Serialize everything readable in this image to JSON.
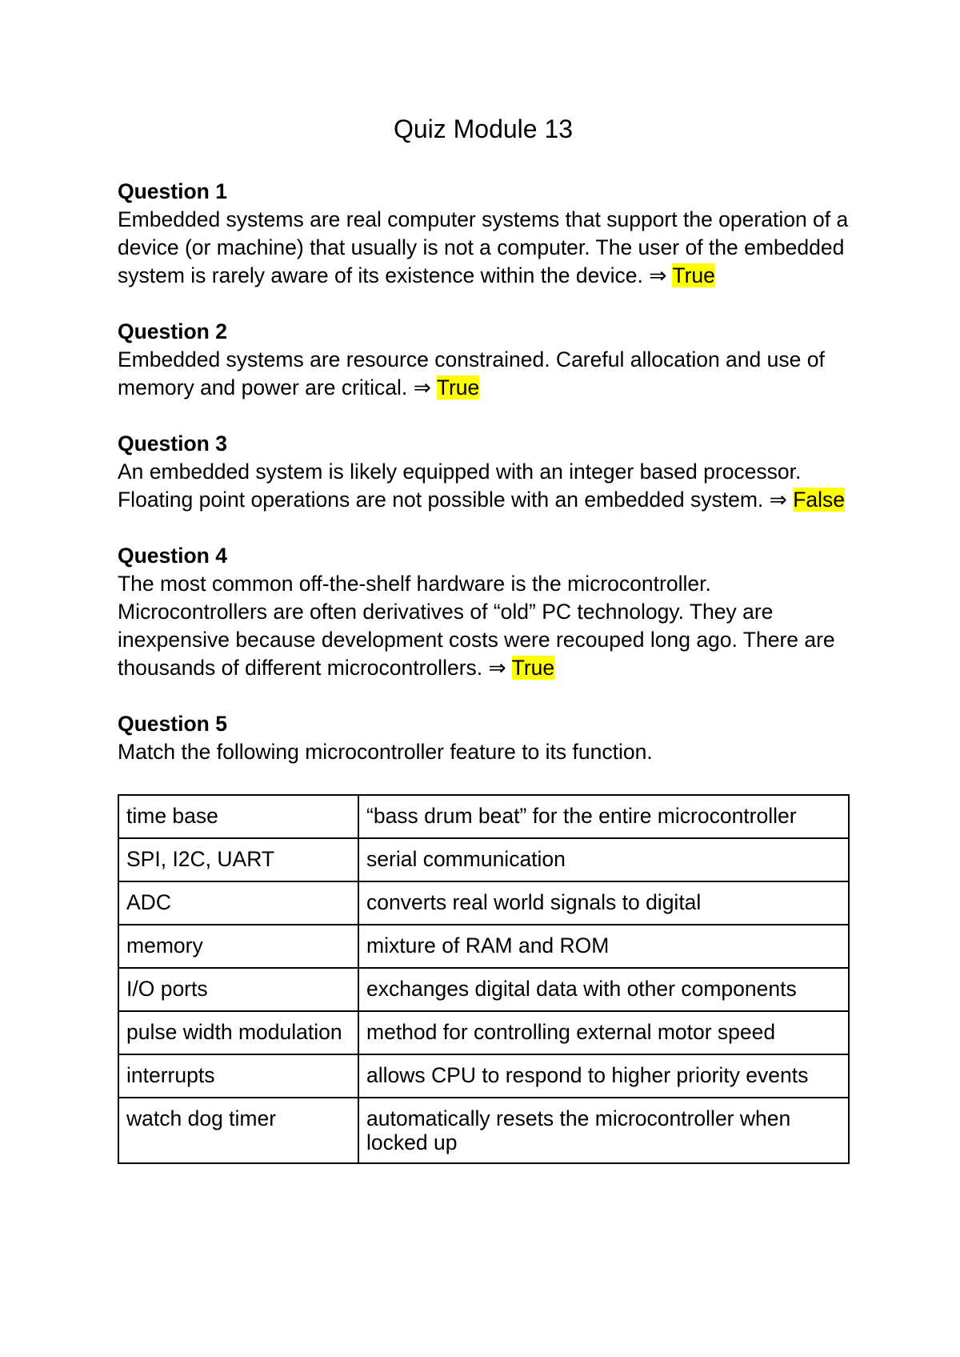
{
  "document": {
    "title": "Quiz Module 13",
    "arrow": "⇒",
    "questions": [
      {
        "heading": "Question 1",
        "text": "Embedded systems are real computer systems that support the operation of a device (or machine) that usually is not a computer. The user of the embedded system is rarely aware of its existence within the device.",
        "answer": "True"
      },
      {
        "heading": "Question 2",
        "text": "Embedded systems are resource constrained. Careful allocation and use of memory and power are critical.",
        "answer": "True"
      },
      {
        "heading": "Question 3",
        "text": "An embedded system is likely equipped with an integer based processor. Floating point operations are not possible with an embedded system.",
        "answer": "False"
      },
      {
        "heading": "Question 4",
        "text": "The most common off-the-shelf hardware is the microcontroller. Microcontrollers are often derivatives of “old” PC technology. They are inexpensive because development costs were recouped long ago. There are thousands of different microcontrollers.",
        "answer": "True"
      },
      {
        "heading": "Question 5",
        "text": "Match the following microcontroller feature to its function."
      }
    ],
    "highlight_color": "#ffff00",
    "match_table": [
      {
        "feature": "time base",
        "function": "“bass drum beat” for the entire microcontroller"
      },
      {
        "feature": "SPI, I2C, UART",
        "function": "serial communication"
      },
      {
        "feature": "ADC",
        "function": "converts real world signals to digital"
      },
      {
        "feature": "memory",
        "function": "mixture of RAM and ROM"
      },
      {
        "feature": "I/O ports",
        "function": "exchanges digital data with other components"
      },
      {
        "feature": "pulse width modulation",
        "function": "method for controlling external motor speed"
      },
      {
        "feature": "interrupts",
        "function": "allows CPU to respond to higher priority events"
      },
      {
        "feature": "watch dog timer",
        "function": "automatically resets the microcontroller when locked up"
      }
    ]
  }
}
